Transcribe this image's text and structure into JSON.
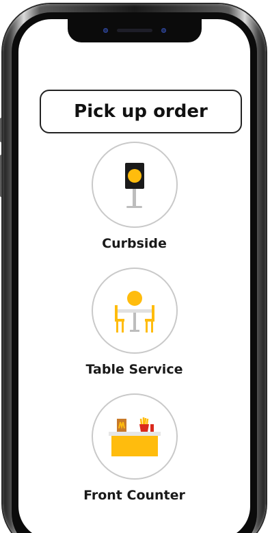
{
  "header": {
    "title": "Pick up order"
  },
  "options": [
    {
      "label": "Curbside",
      "icon": "curbside-sign-icon"
    },
    {
      "label": "Table Service",
      "icon": "table-service-icon"
    },
    {
      "label": "Front Counter",
      "icon": "front-counter-icon"
    }
  ],
  "colors": {
    "accent_yellow": "#FFBC0D",
    "accent_red": "#DA291C",
    "pole_gray": "#BDBDBD",
    "circle_border": "#C9C9C9",
    "text": "#111111"
  }
}
